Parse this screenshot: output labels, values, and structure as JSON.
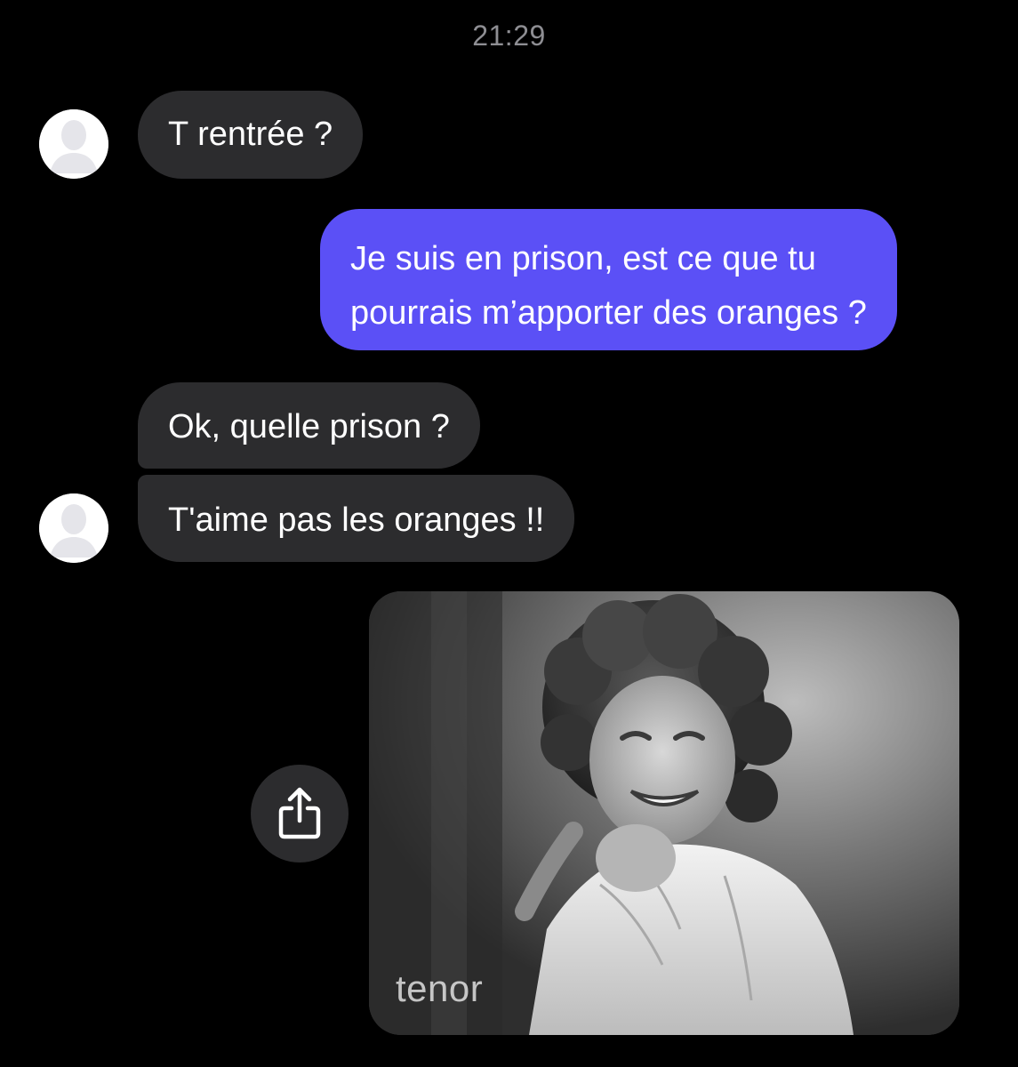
{
  "header": {
    "time": "21:29"
  },
  "messages": [
    {
      "direction": "incoming",
      "text": "T rentrée ?"
    },
    {
      "direction": "outgoing",
      "lines": [
        "Je suis en prison, est ce que tu",
        "pourrais m’apporter des oranges ?"
      ]
    },
    {
      "direction": "incoming",
      "text": "Ok, quelle prison ?"
    },
    {
      "direction": "incoming",
      "text": "T'aime pas les oranges !!"
    }
  ],
  "gif": {
    "provider_label": "tenor"
  },
  "icons": {
    "avatar": "person-silhouette-icon",
    "share": "share-icon"
  },
  "colors": {
    "background": "#000000",
    "incoming_bubble": "#2c2c2e",
    "outgoing_bubble": "#5b50f6",
    "timestamp": "#8e8e93"
  }
}
